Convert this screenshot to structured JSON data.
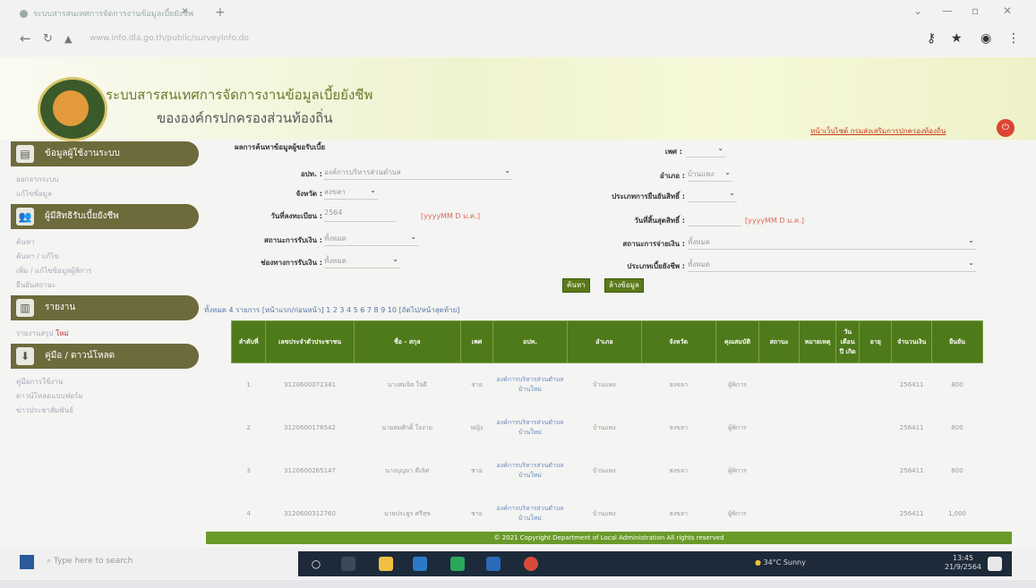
{
  "browser": {
    "tab_title": "ระบบสารสนเทศการจัดการงานข้อมูลเบี้ยยังชีพ",
    "url": "www.info.dla.go.th/public/surveyInfo.do"
  },
  "header": {
    "title_line1": "ระบบสารสนเทศการจัดการงานข้อมูลเบี้ยยังชีพ",
    "title_line2": "ขององค์กรปกครองส่วนท้องถิ่น",
    "top_link": "หน้าเว็บไซต์ กรมส่งเสริมการปกครองท้องถิ่น"
  },
  "sidebar": {
    "sections": [
      {
        "label": "ข้อมูลผู้ใช้งานระบบ",
        "items": [
          "ออกจากระบบ",
          "แก้ไขข้อมูล"
        ]
      },
      {
        "label": "ผู้มีสิทธิรับเบี้ยยังชีพ",
        "items": [
          "ค้นหา",
          "ค้นหา / แก้ไข",
          "เพิ่ม / แก้ไขข้อมูลผู้พิการ",
          "ยืนยันสถานะ"
        ]
      },
      {
        "label": "รายงาน",
        "items": [
          "รายงานสรุป",
          "ใหม่"
        ]
      },
      {
        "label": "คู่มือ / ดาวน์โหลด",
        "items": [
          "คู่มือการใช้งาน",
          "ดาวน์โหลดแบบฟอร์ม",
          "ข่าวประชาสัมพันธ์"
        ]
      }
    ]
  },
  "form": {
    "section_label": "ผลการค้นหาข้อมูลผู้ขอรับเบี้ย",
    "province_label": "อปท. :",
    "province_value": "องค์การบริหารส่วนตำบล",
    "amphur_label": "อำเภอ :",
    "amphur_value": "บ้านแพง",
    "changwat_label": "จังหวัด :",
    "changwat_value": "สงขลา",
    "type_label": "ประเภทการยืนยันสิทธิ์ :",
    "date_from_label": "วันที่ลงทะเบียน :",
    "date_from_value": "2564",
    "date_format": "[yyyyMM D ม.ค.]",
    "date_to_label": "วันที่สิ้นสุดสิทธิ์ :",
    "date_to_format": "[yyyyMM D ม.ค.]",
    "status_label": "สถานะการรับเงิน :",
    "status_value": "ทั้งหมด",
    "pay_label": "สถานะการจ่ายเงิน :",
    "pay_value": "ทั้งหมด",
    "welfare_label": "ช่องทางการรับเงิน :",
    "welfare_value": "ทั้งหมด",
    "detail_label": "ประเภทเบี้ยยังชีพ :",
    "detail_value": "ทั้งหมด",
    "search_button": "ค้นหา",
    "clear_button": "ล้างข้อมูล",
    "gender_label": "เพศ :"
  },
  "pager": "ทั้งหมด 4 รายการ [หน้าแรก/ก่อนหน้า] 1 2 3 4 5 6 7 8 9 10 [ถัดไป/หน้าสุดท้าย]",
  "table": {
    "headers": [
      "ลำดับที่",
      "เลขประจำตัวประชาชน",
      "ชื่อ - สกุล",
      "เพศ",
      "อปท.",
      "อำเภอ",
      "จังหวัด",
      "คุณสมบัติ",
      "สถานะ",
      "หมายเหตุ",
      "วัน เดือน ปี เกิด",
      "อายุ",
      "จำนวนเงิน",
      "ยืนยัน"
    ],
    "rows": [
      [
        "1",
        "3120600072341",
        "นางสมจิต ใจดี",
        "ชาย",
        "องค์การบริหารส่วนตำบลบ้านใหม่",
        "บ้านแพง",
        "สงขลา",
        "ผู้พิการ",
        "",
        "",
        "",
        "",
        "256411",
        "800"
      ],
      [
        "2",
        "3120600176542",
        "นายสมศักดิ์ ใจงาม",
        "หญิง",
        "องค์การบริหารส่วนตำบลบ้านใหม่",
        "บ้านแพง",
        "สงขลา",
        "ผู้พิการ",
        "",
        "",
        "",
        "",
        "256411",
        "800"
      ],
      [
        "3",
        "3120600265147",
        "นางบุญมา ดีเลิศ",
        "ชาย",
        "องค์การบริหารส่วนตำบลบ้านใหม่",
        "บ้านแพง",
        "สงขลา",
        "ผู้พิการ",
        "",
        "",
        "",
        "",
        "256411",
        "800"
      ],
      [
        "4",
        "3120600312760",
        "นายประยูร ศรีสุข",
        "ชาย",
        "องค์การบริหารส่วนตำบลบ้านใหม่",
        "บ้านแพง",
        "สงขลา",
        "ผู้พิการ",
        "",
        "",
        "",
        "",
        "256411",
        "1,000"
      ]
    ]
  },
  "footer": "© 2021 Copyright Department of Local Administration All rights reserved",
  "taskbar": {
    "search_placeholder": "Type here to search",
    "weather": "34°C Sunny",
    "time": "13:45",
    "date": "21/9/2564"
  }
}
